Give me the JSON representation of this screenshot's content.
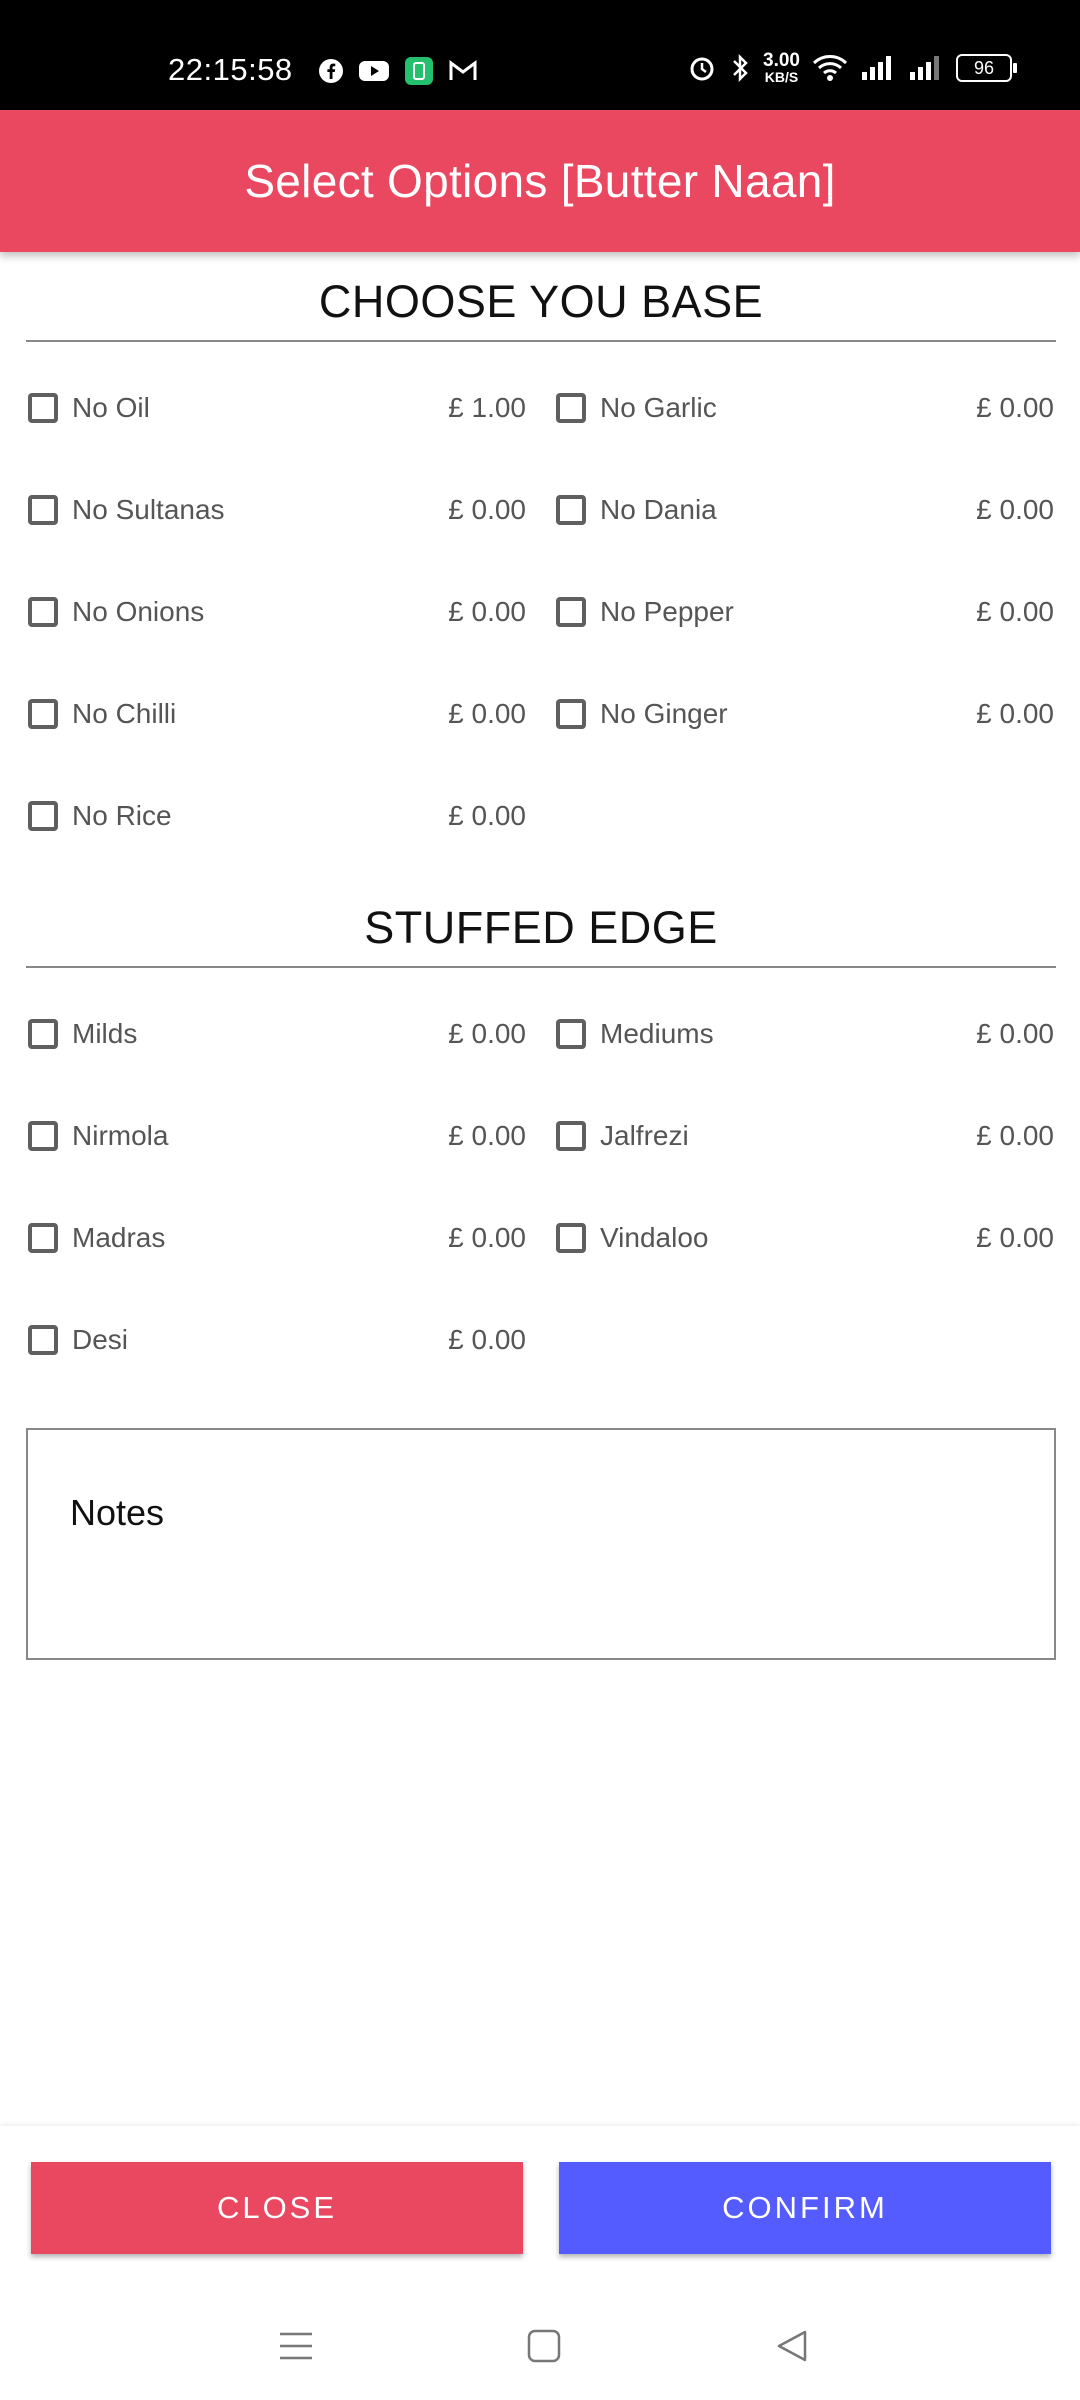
{
  "status_bar": {
    "time": "22:15:58",
    "net_speed_value": "3.00",
    "net_speed_unit": "KB/S",
    "battery": "96",
    "left_icons": [
      "facebook-icon",
      "youtube-icon",
      "app-icon",
      "gmail-icon"
    ],
    "right_icons": [
      "alarm-icon",
      "bluetooth-icon",
      "wifi-icon",
      "signal-icon",
      "signal-icon"
    ]
  },
  "header": {
    "title": "Select Options [Butter Naan]",
    "color": "#ea4760"
  },
  "sections": {
    "base": {
      "title": "CHOOSE YOU BASE",
      "options": [
        {
          "label": "No Oil",
          "price": "£ 1.00"
        },
        {
          "label": "No Garlic",
          "price": "£ 0.00"
        },
        {
          "label": "No Sultanas",
          "price": "£ 0.00"
        },
        {
          "label": "No Dania",
          "price": "£ 0.00"
        },
        {
          "label": "No Onions",
          "price": "£ 0.00"
        },
        {
          "label": "No Pepper",
          "price": "£ 0.00"
        },
        {
          "label": "No Chilli",
          "price": "£ 0.00"
        },
        {
          "label": "No Ginger",
          "price": "£ 0.00"
        },
        {
          "label": "No Rice",
          "price": "£ 0.00"
        }
      ]
    },
    "edge": {
      "title": "STUFFED EDGE",
      "options": [
        {
          "label": "Milds",
          "price": "£ 0.00"
        },
        {
          "label": "Mediums",
          "price": "£ 0.00"
        },
        {
          "label": "Nirmola",
          "price": "£ 0.00"
        },
        {
          "label": "Jalfrezi",
          "price": "£ 0.00"
        },
        {
          "label": "Madras",
          "price": "£ 0.00"
        },
        {
          "label": "Vindaloo",
          "price": "£ 0.00"
        },
        {
          "label": "Desi",
          "price": "£ 0.00"
        }
      ]
    }
  },
  "notes": {
    "label": "Notes"
  },
  "buttons": {
    "close": "CLOSE",
    "confirm": "CONFIRM",
    "close_color": "#ea4760",
    "confirm_color": "#545cff"
  },
  "nav_icons": [
    "menu-icon",
    "home-icon",
    "back-icon"
  ]
}
